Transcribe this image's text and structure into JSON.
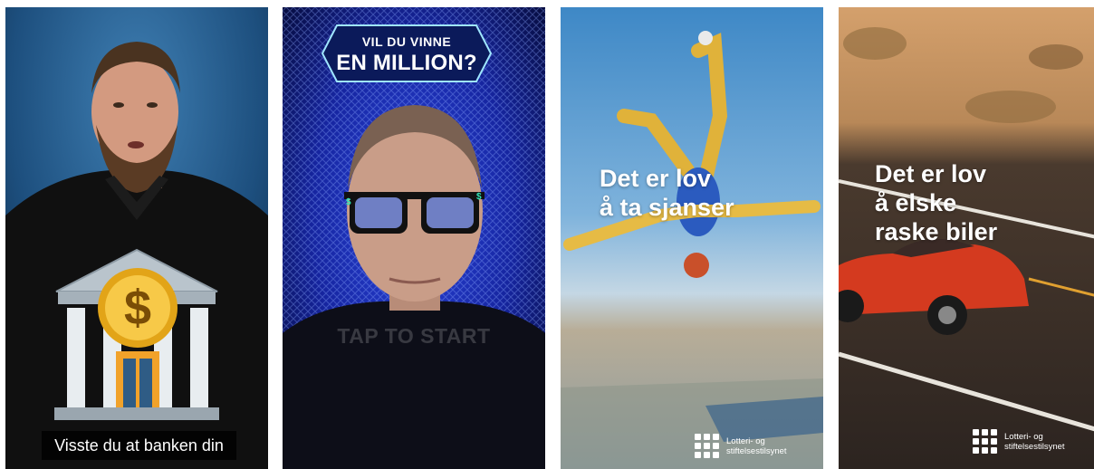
{
  "panels": [
    {
      "caption": "Visste du at banken din"
    },
    {
      "badge_line1": "VIL DU VINNE",
      "badge_line2": "EN MILLION?",
      "overlay_prompt": "TAP TO START"
    },
    {
      "headline_line1": "Det er lov",
      "headline_line2": "å ta sjanser",
      "brand_line1": "Lotteri- og",
      "brand_line2": "stiftelsestilsynet"
    },
    {
      "headline_line1": "Det er lov",
      "headline_line2": "å elske",
      "headline_line3": "raske biler",
      "brand_line1": "Lotteri- og",
      "brand_line2": "stiftelsestilsynet"
    }
  ],
  "icons": [
    "bank-emoji-icon",
    "dollar-coin-icon",
    "sunglasses-icon",
    "lottery-authority-logo-icon"
  ],
  "colors": {
    "panel1_bg": "#1f5a8c",
    "panel2_bg": "#1428a8",
    "panel3_sky": "#5b9ccd",
    "panel4_road": "#3a2f27",
    "car_red": "#d43a1f"
  }
}
